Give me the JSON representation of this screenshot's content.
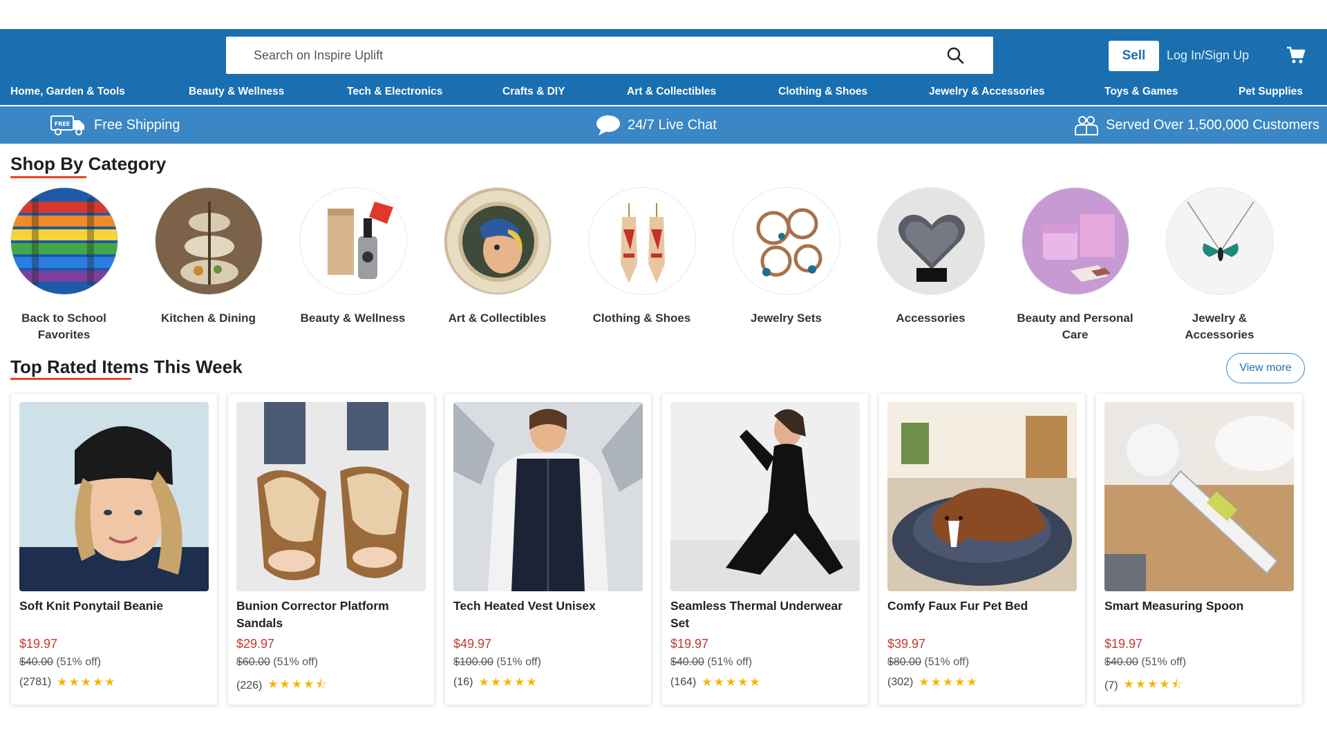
{
  "search": {
    "placeholder": "Search on Inspire Uplift"
  },
  "header": {
    "sell_label": "Sell",
    "login_label": "Log In/Sign Up"
  },
  "nav": [
    "Home, Garden & Tools",
    "Beauty & Wellness",
    "Tech & Electronics",
    "Crafts & DIY",
    "Art & Collectibles",
    "Clothing & Shoes",
    "Jewelry & Accessories",
    "Toys & Games",
    "Pet Supplies"
  ],
  "benefits": {
    "free_shipping": "Free Shipping",
    "free_badge": "FREE",
    "live_chat": "24/7 Live Chat",
    "customers": "Served Over 1,500,000 Customers"
  },
  "shop_by_category": {
    "title": "Shop By Category",
    "categories": [
      {
        "label": "Back to School Favorites"
      },
      {
        "label": "Kitchen & Dining"
      },
      {
        "label": "Beauty & Wellness"
      },
      {
        "label": "Art & Collectibles"
      },
      {
        "label": "Clothing & Shoes"
      },
      {
        "label": "Jewelry Sets"
      },
      {
        "label": "Accessories"
      },
      {
        "label": "Beauty and Personal Care"
      },
      {
        "label": "Jewelry & Accessories"
      }
    ]
  },
  "top_rated": {
    "title": "Top Rated Items This Week",
    "view_more": "View more",
    "products": [
      {
        "name": "Soft Knit Ponytail Beanie",
        "price": "$19.97",
        "old_price": "$40.00",
        "discount": "(51% off)",
        "reviews": "(2781)",
        "rating": 5
      },
      {
        "name": "Bunion Corrector Platform Sandals",
        "price": "$29.97",
        "old_price": "$60.00",
        "discount": "(51% off)",
        "reviews": "(226)",
        "rating": 4.5
      },
      {
        "name": "Tech Heated Vest Unisex",
        "price": "$49.97",
        "old_price": "$100.00",
        "discount": "(51% off)",
        "reviews": "(16)",
        "rating": 5
      },
      {
        "name": "Seamless Thermal Underwear Set",
        "price": "$19.97",
        "old_price": "$40.00",
        "discount": "(51% off)",
        "reviews": "(164)",
        "rating": 5
      },
      {
        "name": "Comfy Faux Fur Pet Bed",
        "price": "$39.97",
        "old_price": "$80.00",
        "discount": "(51% off)",
        "reviews": "(302)",
        "rating": 5
      },
      {
        "name": "Smart Measuring Spoon",
        "price": "$19.97",
        "old_price": "$40.00",
        "discount": "(51% off)",
        "reviews": "(7)",
        "rating": 4.5
      }
    ]
  },
  "colors": {
    "brand_blue": "#1a6fb0",
    "bar_blue": "#3b86c4",
    "accent_red": "#e8431f",
    "price_red": "#c0392b",
    "star": "#f2b705"
  }
}
